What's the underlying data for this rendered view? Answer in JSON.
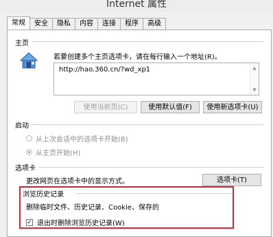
{
  "window": {
    "title": "Internet 属性"
  },
  "tabs": [
    {
      "label": "常规"
    },
    {
      "label": "安全"
    },
    {
      "label": "隐私"
    },
    {
      "label": "内容"
    },
    {
      "label": "连接"
    },
    {
      "label": "程序"
    },
    {
      "label": "高级"
    }
  ],
  "home": {
    "section_label": "主页",
    "hint": "若要创建多个主页选项卡，请在每行输入一个地址(R)。",
    "url": "http://hao.360.cn/?wd_xp1",
    "buttons": {
      "use_current": "使用当前页(C)",
      "use_default": "使用默认值(F)",
      "use_new_tab": "使用新选项卡(U)"
    }
  },
  "startup": {
    "section_label": "启动",
    "option_last_session": "从上次会话中的选项卡开始(B)",
    "option_home": "从主页开始(H)"
  },
  "tabs_section": {
    "section_label": "选项卡",
    "description": "更改网页在选项卡中的显示方式。",
    "button": "选项卡(T)"
  },
  "history": {
    "section_label": "浏览历史记录",
    "description": "删除临时文件、历史记录、Cookie、保存的",
    "checkbox_label": "退出时删除浏览历史记录(W)",
    "checkbox_checked": true
  }
}
